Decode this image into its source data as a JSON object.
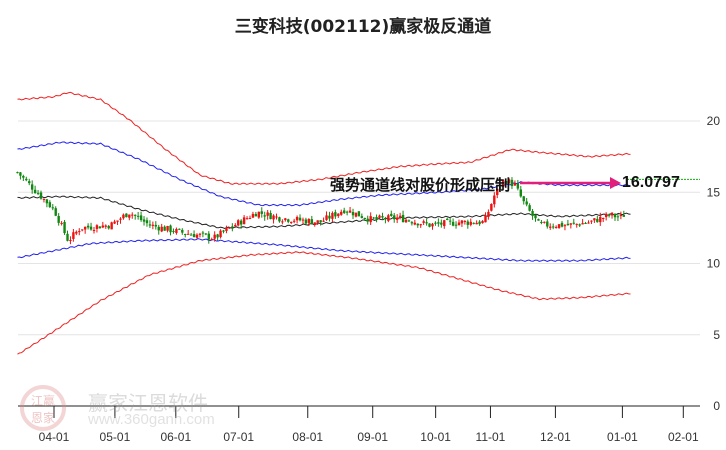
{
  "chart_data": {
    "type": "line",
    "title": "三变科技(002112)赢家极反通道",
    "x_unit": "days from 04-01",
    "xlim": [
      -18,
      318
    ],
    "ylim": [
      0,
      21.7
    ],
    "yticks": [
      0,
      5,
      10,
      15,
      20
    ],
    "xticks": [
      {
        "label": "04-01",
        "day": 0
      },
      {
        "label": "05-01",
        "day": 30
      },
      {
        "label": "06-01",
        "day": 60
      },
      {
        "label": "07-01",
        "day": 91
      },
      {
        "label": "08-01",
        "day": 125
      },
      {
        "label": "09-01",
        "day": 157
      },
      {
        "label": "10-01",
        "day": 188
      },
      {
        "label": "11-01",
        "day": 215
      },
      {
        "label": "12-01",
        "day": 247
      },
      {
        "label": "01-01",
        "day": 280
      },
      {
        "label": "02-01",
        "day": 310
      }
    ],
    "series": [
      {
        "name": "upper-red",
        "color": "#ee2222",
        "points": [
          [
            -18,
            21.5
          ],
          [
            0,
            21.7
          ],
          [
            7,
            22.0
          ],
          [
            23,
            21.5
          ],
          [
            37,
            20.1
          ],
          [
            55,
            18.0
          ],
          [
            72,
            16.2
          ],
          [
            87,
            15.6
          ],
          [
            111,
            15.6
          ],
          [
            131,
            15.9
          ],
          [
            151,
            16.4
          ],
          [
            170,
            16.8
          ],
          [
            190,
            17.0
          ],
          [
            205,
            17.1
          ],
          [
            225,
            18.0
          ],
          [
            239,
            17.8
          ],
          [
            264,
            17.5
          ],
          [
            284,
            17.7
          ]
        ]
      },
      {
        "name": "upper-blue",
        "color": "#2222ee",
        "points": [
          [
            -18,
            18.0
          ],
          [
            3,
            18.5
          ],
          [
            23,
            18.4
          ],
          [
            42,
            17.3
          ],
          [
            62,
            15.9
          ],
          [
            82,
            14.7
          ],
          [
            101,
            14.1
          ],
          [
            121,
            14.1
          ],
          [
            141,
            14.5
          ],
          [
            161,
            14.8
          ],
          [
            190,
            15.0
          ],
          [
            210,
            15.2
          ],
          [
            230,
            15.7
          ],
          [
            249,
            15.5
          ],
          [
            284,
            15.5
          ]
        ]
      },
      {
        "name": "middle",
        "color": "#222222",
        "points": [
          [
            -18,
            14.6
          ],
          [
            3,
            14.7
          ],
          [
            23,
            14.6
          ],
          [
            42,
            13.8
          ],
          [
            62,
            13.1
          ],
          [
            82,
            12.5
          ],
          [
            111,
            12.6
          ],
          [
            141,
            12.9
          ],
          [
            170,
            13.2
          ],
          [
            205,
            13.3
          ],
          [
            230,
            13.5
          ],
          [
            249,
            13.3
          ],
          [
            284,
            13.5
          ]
        ]
      },
      {
        "name": "lower-blue",
        "color": "#2222ee",
        "points": [
          [
            -18,
            10.4
          ],
          [
            18,
            11.4
          ],
          [
            42,
            11.6
          ],
          [
            72,
            11.7
          ],
          [
            111,
            11.3
          ],
          [
            141,
            10.9
          ],
          [
            180,
            10.6
          ],
          [
            230,
            10.2
          ],
          [
            259,
            10.2
          ],
          [
            284,
            10.4
          ]
        ]
      },
      {
        "name": "lower-red",
        "color": "#ee2222",
        "points": [
          [
            -18,
            3.6
          ],
          [
            -7,
            4.6
          ],
          [
            23,
            7.4
          ],
          [
            47,
            9.2
          ],
          [
            72,
            10.2
          ],
          [
            97,
            10.6
          ],
          [
            121,
            10.8
          ],
          [
            146,
            10.4
          ],
          [
            180,
            9.7
          ],
          [
            220,
            8.1
          ],
          [
            239,
            7.5
          ],
          [
            259,
            7.6
          ],
          [
            284,
            7.9
          ]
        ]
      }
    ],
    "close": [
      [
        -18,
        16.4
      ],
      [
        -7,
        14.8
      ],
      [
        0,
        13.8
      ],
      [
        7,
        11.6
      ],
      [
        13,
        12.5
      ],
      [
        28,
        12.7
      ],
      [
        37,
        13.6
      ],
      [
        47,
        12.7
      ],
      [
        62,
        12.2
      ],
      [
        79,
        11.8
      ],
      [
        89,
        12.7
      ],
      [
        100,
        13.6
      ],
      [
        111,
        13.2
      ],
      [
        131,
        12.9
      ],
      [
        143,
        13.8
      ],
      [
        156,
        13.1
      ],
      [
        170,
        13.2
      ],
      [
        185,
        12.7
      ],
      [
        200,
        12.9
      ],
      [
        212,
        12.9
      ],
      [
        217,
        14.8
      ],
      [
        222,
        15.9
      ],
      [
        227,
        15.5
      ],
      [
        232,
        14.1
      ],
      [
        239,
        12.7
      ],
      [
        254,
        12.7
      ],
      [
        264,
        12.9
      ],
      [
        274,
        13.4
      ],
      [
        280,
        13.2
      ],
      [
        282,
        13.8
      ]
    ],
    "annotation": {
      "text": "强势通道线对股价形成压制",
      "value": "16.0797",
      "level": 15.9
    },
    "watermark": {
      "name": "赢家江恩软件",
      "url": "www.360gann.com",
      "seal": "江赢恩家"
    }
  }
}
